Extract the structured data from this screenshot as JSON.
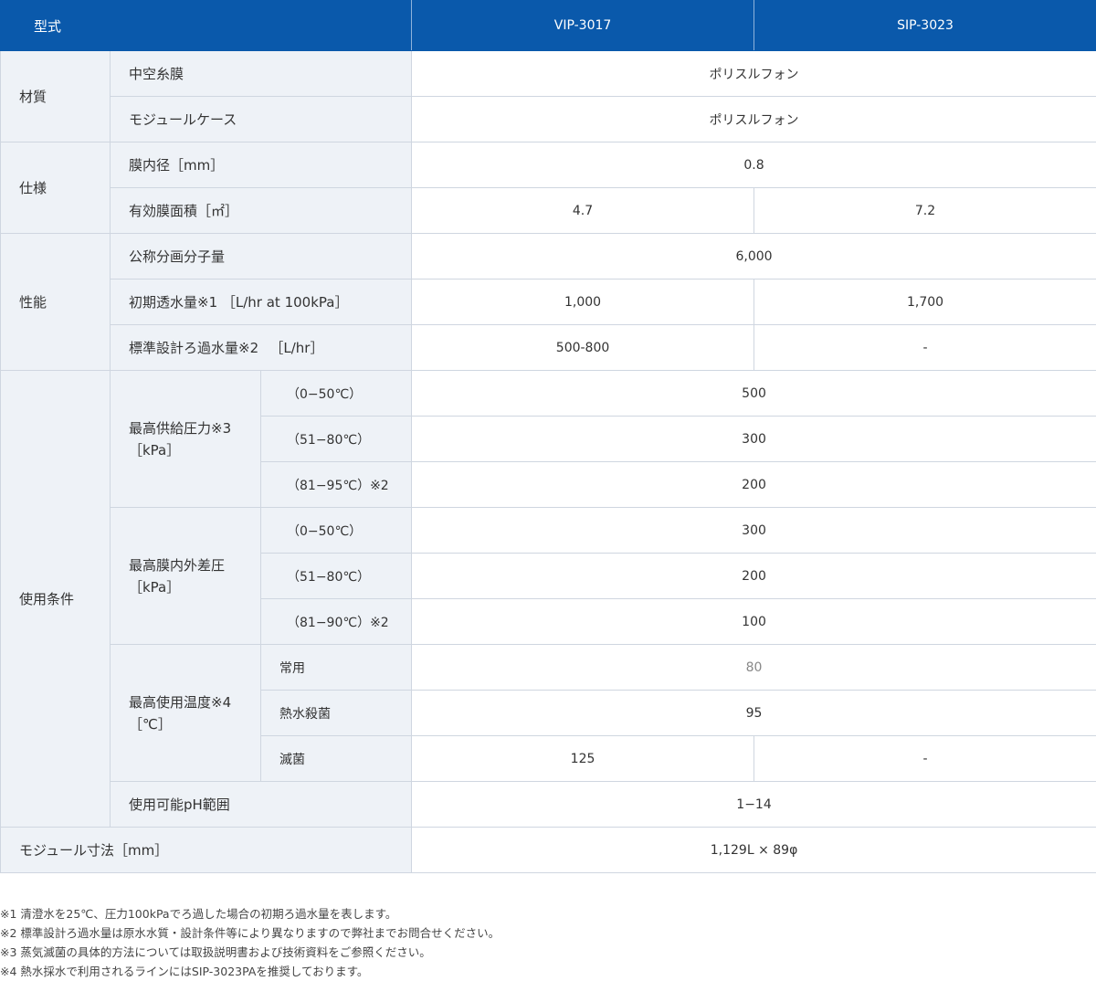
{
  "header": {
    "label": "型式",
    "models": [
      "VIP-3017",
      "SIP-3023"
    ]
  },
  "material": {
    "group": "材質",
    "hollow_fiber": {
      "label": "中空糸膜",
      "value": "ポリスルフォン"
    },
    "module_case": {
      "label": "モジュールケース",
      "value": "ポリスルフォン"
    }
  },
  "spec": {
    "group": "仕様",
    "inner_diameter": {
      "label": "膜内径［mm］",
      "value": "0.8"
    },
    "effective_area": {
      "label": "有効膜面積［㎡］",
      "values": [
        "4.7",
        "7.2"
      ]
    }
  },
  "performance": {
    "group": "性能",
    "mwco": {
      "label": "公称分画分子量",
      "value": "6,000"
    },
    "initial_flux": {
      "label": "初期透水量※1 ［L/hr at 100kPa］",
      "values": [
        "1,000",
        "1,700"
      ]
    },
    "design_flux": {
      "label": "標準設計ろ過水量※2 　［L/hr］",
      "values": [
        "500-800",
        "-"
      ]
    }
  },
  "conditions": {
    "group": "使用条件",
    "max_feed_pressure": {
      "label_line1": "最高供給圧力※3",
      "label_line2": "［kPa］",
      "rows": [
        {
          "temp": "（0−50℃）",
          "value": "500"
        },
        {
          "temp": "（51−80℃）",
          "value": "300"
        },
        {
          "temp": "（81−95℃）※2",
          "value": "200"
        }
      ]
    },
    "max_tmp": {
      "label_line1": "最高膜内外差圧",
      "label_line2": "［kPa］",
      "rows": [
        {
          "temp": "（0−50℃）",
          "value": "300"
        },
        {
          "temp": "（51−80℃）",
          "value": "200"
        },
        {
          "temp": "（81−90℃）※2",
          "value": "100"
        }
      ]
    },
    "max_temp": {
      "label_line1": "最高使用温度※4",
      "label_line2": "［℃］",
      "normal": {
        "label": "常用",
        "value": "80"
      },
      "hot_water": {
        "label": "熱水殺菌",
        "value": "95"
      },
      "sterilize": {
        "label": "滅菌",
        "values": [
          "125",
          "-"
        ]
      }
    },
    "ph_range": {
      "label": "使用可能pH範囲",
      "value": "1−14"
    }
  },
  "dimensions": {
    "label": "モジュール寸法［mm］",
    "value": "1,129L × 89φ"
  },
  "notes": [
    "※1 清澄水を25℃、圧力100kPaでろ過した場合の初期ろ過水量を表します。",
    "※2 標準設計ろ過水量は原水水質・設計条件等により異なりますので弊社までお問合せください。",
    "※3 蒸気滅菌の具体的方法については取扱説明書および技術資料をご参照ください。",
    "※4 熱水採水で利用されるラインにはSIP-3023PAを推奨しております。"
  ]
}
